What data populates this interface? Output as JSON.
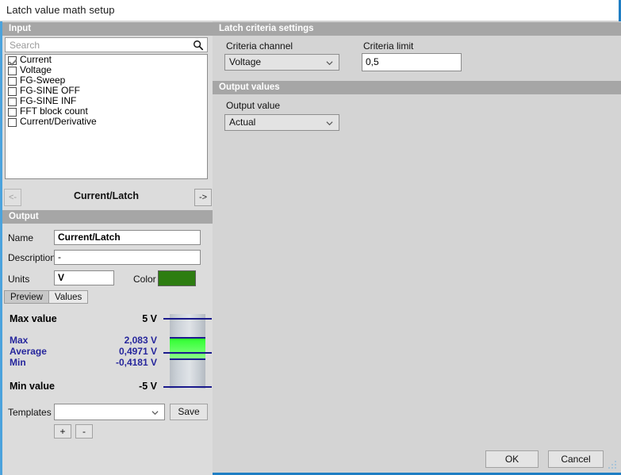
{
  "window": {
    "title": "Latch value math setup",
    "accent": "#1f7ec4"
  },
  "input": {
    "header": "Input",
    "search": {
      "placeholder": "Search",
      "value": "",
      "icon": "search-icon"
    },
    "items": [
      {
        "label": "Current",
        "checked": true
      },
      {
        "label": "Voltage",
        "checked": false
      },
      {
        "label": "FG-Sweep",
        "checked": false
      },
      {
        "label": "FG-SINE OFF",
        "checked": false
      },
      {
        "label": "FG-SINE INF",
        "checked": false
      },
      {
        "label": "FFT block count",
        "checked": false
      },
      {
        "label": "Current/Derivative",
        "checked": false
      }
    ]
  },
  "nav": {
    "prev_label": "<-",
    "next_label": "->",
    "current_channel": "Current/Latch",
    "prev_enabled": false,
    "next_enabled": true
  },
  "criteria": {
    "header": "Latch criteria settings",
    "channel_label": "Criteria channel",
    "channel_value": "Voltage",
    "limit_label": "Criteria limit",
    "limit_value": "0,5"
  },
  "output_values": {
    "header": "Output values",
    "value_label": "Output value",
    "value": "Actual"
  },
  "output": {
    "header": "Output",
    "name_label": "Name",
    "name_value": "Current/Latch",
    "description_label": "Description",
    "description_value": "-",
    "units_label": "Units",
    "units_value": "V",
    "color_label": "Color",
    "color_value": "#2d7d11"
  },
  "tabs": [
    {
      "label": "Preview",
      "active": true
    },
    {
      "label": "Values",
      "active": false
    }
  ],
  "preview": {
    "max_value_label": "Max value",
    "max_value": "5 V",
    "min_value_label": "Min value",
    "min_value": "-5 V",
    "stats": [
      {
        "label": "Max",
        "value": "2,083 V"
      },
      {
        "label": "Average",
        "value": "0,4971 V"
      },
      {
        "label": "Min",
        "value": "-0,4181 V"
      }
    ],
    "bar_color": "#3dff3d",
    "line_color": "#1a1a8c"
  },
  "templates": {
    "label": "Templates",
    "value": "",
    "save_label": "Save",
    "add_label": "+",
    "remove_label": "-"
  },
  "footer": {
    "ok_label": "OK",
    "cancel_label": "Cancel"
  }
}
